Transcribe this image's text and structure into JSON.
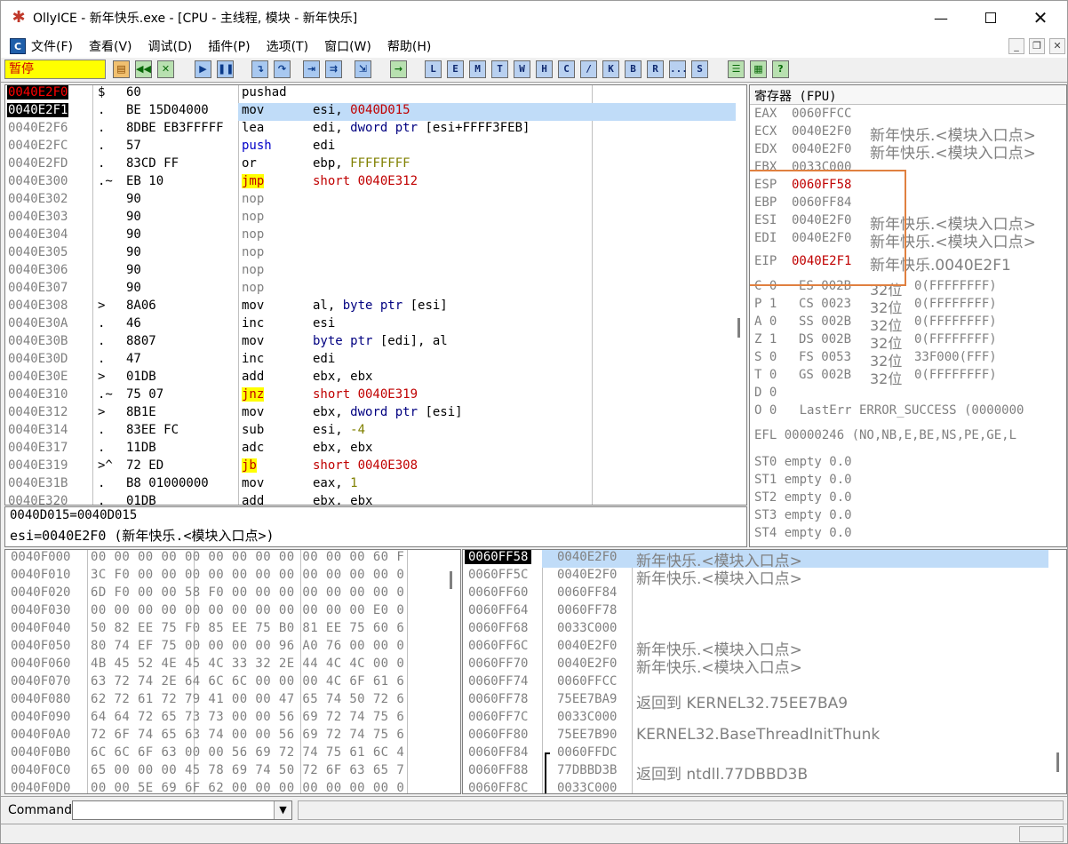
{
  "window": {
    "title": "OllyICE - 新年快乐.exe - [CPU -  主线程, 模块 - 新年快乐]",
    "minimize_icon": "minimize-icon",
    "maximize_icon": "maximize-icon",
    "close_icon": "close-icon"
  },
  "menu": {
    "items": [
      "文件(F)",
      "查看(V)",
      "调试(D)",
      "插件(P)",
      "选项(T)",
      "窗口(W)",
      "帮助(H)"
    ]
  },
  "toolbar": {
    "status": "暂停",
    "letters": [
      "L",
      "E",
      "M",
      "T",
      "W",
      "H",
      "C",
      "/",
      "K",
      "B",
      "R",
      "...",
      "S"
    ]
  },
  "disasm": {
    "rows": [
      {
        "addr": "0040E2F0",
        "mark": "$",
        "hex": "60",
        "mn": "pushad",
        "op": "",
        "addrstyle": "eip"
      },
      {
        "addr": "0040E2F1",
        "mark": ".",
        "hex": "BE 15D04000",
        "mn": "mov",
        "op": "esi, 0040D015",
        "addrstyle": "cur"
      },
      {
        "addr": "0040E2F6",
        "mark": ".",
        "hex": "8DBE EB3FFFFF",
        "mn": "lea",
        "op": "edi, dword ptr [esi+FFFF3FEB]",
        "addrstyle": ""
      },
      {
        "addr": "0040E2FC",
        "mark": ".",
        "hex": "57",
        "mn": "push",
        "op": "edi",
        "addrstyle": ""
      },
      {
        "addr": "0040E2FD",
        "mark": ".",
        "hex": "83CD FF",
        "mn": "or",
        "op": "ebp, FFFFFFFF",
        "addrstyle": ""
      },
      {
        "addr": "0040E300",
        "mark": ".~",
        "hex": "EB 10",
        "mn": "jmp",
        "op": "short 0040E312",
        "addrstyle": ""
      },
      {
        "addr": "0040E302",
        "mark": "",
        "hex": "90",
        "mn": "nop",
        "op": "",
        "addrstyle": ""
      },
      {
        "addr": "0040E303",
        "mark": "",
        "hex": "90",
        "mn": "nop",
        "op": "",
        "addrstyle": ""
      },
      {
        "addr": "0040E304",
        "mark": "",
        "hex": "90",
        "mn": "nop",
        "op": "",
        "addrstyle": ""
      },
      {
        "addr": "0040E305",
        "mark": "",
        "hex": "90",
        "mn": "nop",
        "op": "",
        "addrstyle": ""
      },
      {
        "addr": "0040E306",
        "mark": "",
        "hex": "90",
        "mn": "nop",
        "op": "",
        "addrstyle": ""
      },
      {
        "addr": "0040E307",
        "mark": "",
        "hex": "90",
        "mn": "nop",
        "op": "",
        "addrstyle": ""
      },
      {
        "addr": "0040E308",
        "mark": ">",
        "hex": "8A06",
        "mn": "mov",
        "op": "al, byte ptr [esi]",
        "addrstyle": ""
      },
      {
        "addr": "0040E30A",
        "mark": ".",
        "hex": "46",
        "mn": "inc",
        "op": "esi",
        "addrstyle": ""
      },
      {
        "addr": "0040E30B",
        "mark": ".",
        "hex": "8807",
        "mn": "mov",
        "op": "byte ptr [edi], al",
        "addrstyle": ""
      },
      {
        "addr": "0040E30D",
        "mark": ".",
        "hex": "47",
        "mn": "inc",
        "op": "edi",
        "addrstyle": ""
      },
      {
        "addr": "0040E30E",
        "mark": ">",
        "hex": "01DB",
        "mn": "add",
        "op": "ebx, ebx",
        "addrstyle": ""
      },
      {
        "addr": "0040E310",
        "mark": ".~",
        "hex": "75 07",
        "mn": "jnz",
        "op": "short 0040E319",
        "addrstyle": ""
      },
      {
        "addr": "0040E312",
        "mark": ">",
        "hex": "8B1E",
        "mn": "mov",
        "op": "ebx, dword ptr [esi]",
        "addrstyle": ""
      },
      {
        "addr": "0040E314",
        "mark": ".",
        "hex": "83EE FC",
        "mn": "sub",
        "op": "esi, -4",
        "addrstyle": ""
      },
      {
        "addr": "0040E317",
        "mark": ".",
        "hex": "11DB",
        "mn": "adc",
        "op": "ebx, ebx",
        "addrstyle": ""
      },
      {
        "addr": "0040E319",
        "mark": ">^",
        "hex": "72 ED",
        "mn": "jb",
        "op": "short 0040E308",
        "addrstyle": ""
      },
      {
        "addr": "0040E31B",
        "mark": ".",
        "hex": "B8 01000000",
        "mn": "mov",
        "op": "eax, 1",
        "addrstyle": ""
      },
      {
        "addr": "0040E320",
        "mark": ".",
        "hex": "01DB",
        "mn": "add",
        "op": "ebx, ebx",
        "addrstyle": ""
      }
    ]
  },
  "info": {
    "line1": "0040D015=0040D015",
    "line2": "esi=0040E2F0 (新年快乐.<模块入口点>)"
  },
  "registers": {
    "header": "寄存器 (FPU)",
    "gp": [
      {
        "name": "EAX",
        "val": "0060FFCC",
        "note": ""
      },
      {
        "name": "ECX",
        "val": "0040E2F0",
        "note": "新年快乐.<模块入口点>"
      },
      {
        "name": "EDX",
        "val": "0040E2F0",
        "note": "新年快乐.<模块入口点>"
      },
      {
        "name": "EBX",
        "val": "0033C000",
        "note": ""
      },
      {
        "name": "ESP",
        "val": "0060FF58",
        "note": ""
      },
      {
        "name": "EBP",
        "val": "0060FF84",
        "note": ""
      },
      {
        "name": "ESI",
        "val": "0040E2F0",
        "note": "新年快乐.<模块入口点>"
      },
      {
        "name": "EDI",
        "val": "0040E2F0",
        "note": "新年快乐.<模块入口点>"
      }
    ],
    "eip": {
      "name": "EIP",
      "val": "0040E2F1",
      "note": "新年快乐.0040E2F1"
    },
    "flags": [
      {
        "f": "C 0",
        "seg": "ES 002B",
        "bits": "32位",
        "rng": "0(FFFFFFFF)"
      },
      {
        "f": "P 1",
        "seg": "CS 0023",
        "bits": "32位",
        "rng": "0(FFFFFFFF)"
      },
      {
        "f": "A 0",
        "seg": "SS 002B",
        "bits": "32位",
        "rng": "0(FFFFFFFF)"
      },
      {
        "f": "Z 1",
        "seg": "DS 002B",
        "bits": "32位",
        "rng": "0(FFFFFFFF)"
      },
      {
        "f": "S 0",
        "seg": "FS 0053",
        "bits": "32位",
        "rng": "33F000(FFF)"
      },
      {
        "f": "T 0",
        "seg": "GS 002B",
        "bits": "32位",
        "rng": "0(FFFFFFFF)"
      },
      {
        "f": "D 0",
        "seg": "",
        "bits": "",
        "rng": ""
      }
    ],
    "lasterr": "O 0   LastErr ERROR_SUCCESS (0000000",
    "efl": "EFL 00000246 (NO,NB,E,BE,NS,PE,GE,L",
    "st": [
      "ST0 empty 0.0",
      "ST1 empty 0.0",
      "ST2 empty 0.0",
      "ST3 empty 0.0",
      "ST4 empty 0.0"
    ]
  },
  "dump": {
    "rows": [
      {
        "addr": "0040F000",
        "bytes": "00 00 00 00 00 00 00 00 00 00 00 00 60 F"
      },
      {
        "addr": "0040F010",
        "bytes": "3C F0 00 00 00 00 00 00 00 00 00 00 00 0"
      },
      {
        "addr": "0040F020",
        "bytes": "6D F0 00 00 58 F0 00 00 00 00 00 00 00 0"
      },
      {
        "addr": "0040F030",
        "bytes": "00 00 00 00 00 00 00 00 00 00 00 00 E0 0"
      },
      {
        "addr": "0040F040",
        "bytes": "50 82 EE 75 F0 85 EE 75 B0 81 EE 75 60 6"
      },
      {
        "addr": "0040F050",
        "bytes": "80 74 EF 75 00 00 00 00 96 A0 76 00 00 0"
      },
      {
        "addr": "0040F060",
        "bytes": "4B 45 52 4E 45 4C 33 32 2E 44 4C 4C 00 0"
      },
      {
        "addr": "0040F070",
        "bytes": "63 72 74 2E 64 6C 6C 00 00 00 4C 6F 61 6"
      },
      {
        "addr": "0040F080",
        "bytes": "62 72 61 72 79 41 00 00 47 65 74 50 72 6"
      },
      {
        "addr": "0040F090",
        "bytes": "64 64 72 65 73 73 00 00 56 69 72 74 75 6"
      },
      {
        "addr": "0040F0A0",
        "bytes": "72 6F 74 65 63 74 00 00 56 69 72 74 75 6"
      },
      {
        "addr": "0040F0B0",
        "bytes": "6C 6C 6F 63 00 00 56 69 72 74 75 61 6C 4"
      },
      {
        "addr": "0040F0C0",
        "bytes": "65 00 00 00 45 78 69 74 50 72 6F 63 65 7"
      },
      {
        "addr": "0040F0D0",
        "bytes": "00 00 5E 69 6F 62 00 00 00 00 00 00 00 0"
      }
    ]
  },
  "stack": {
    "rows": [
      {
        "addr": "0060FF58",
        "val": "0040E2F0",
        "note": "新年快乐.<模块入口点>",
        "style": "top"
      },
      {
        "addr": "0060FF5C",
        "val": "0040E2F0",
        "note": "新年快乐.<模块入口点>",
        "style": ""
      },
      {
        "addr": "0060FF60",
        "val": "0060FF84",
        "note": "",
        "style": ""
      },
      {
        "addr": "0060FF64",
        "val": "0060FF78",
        "note": "",
        "style": ""
      },
      {
        "addr": "0060FF68",
        "val": "0033C000",
        "note": "",
        "style": ""
      },
      {
        "addr": "0060FF6C",
        "val": "0040E2F0",
        "note": "新年快乐.<模块入口点>",
        "style": ""
      },
      {
        "addr": "0060FF70",
        "val": "0040E2F0",
        "note": "新年快乐.<模块入口点>",
        "style": ""
      },
      {
        "addr": "0060FF74",
        "val": "0060FFCC",
        "note": "",
        "style": ""
      },
      {
        "addr": "0060FF78",
        "val": "75EE7BA9",
        "note": "返回到 KERNEL32.75EE7BA9",
        "style": ""
      },
      {
        "addr": "0060FF7C",
        "val": "0033C000",
        "note": "",
        "style": ""
      },
      {
        "addr": "0060FF80",
        "val": "75EE7B90",
        "note": "KERNEL32.BaseThreadInitThunk",
        "style": ""
      },
      {
        "addr": "0060FF84",
        "val": "0060FFDC",
        "note": "",
        "style": ""
      },
      {
        "addr": "0060FF88",
        "val": "77DBBD3B",
        "note": "返回到 ntdll.77DBBD3B",
        "style": ""
      },
      {
        "addr": "0060FF8C",
        "val": "0033C000",
        "note": "",
        "style": ""
      }
    ]
  },
  "command": {
    "label": "Command",
    "value": ""
  }
}
